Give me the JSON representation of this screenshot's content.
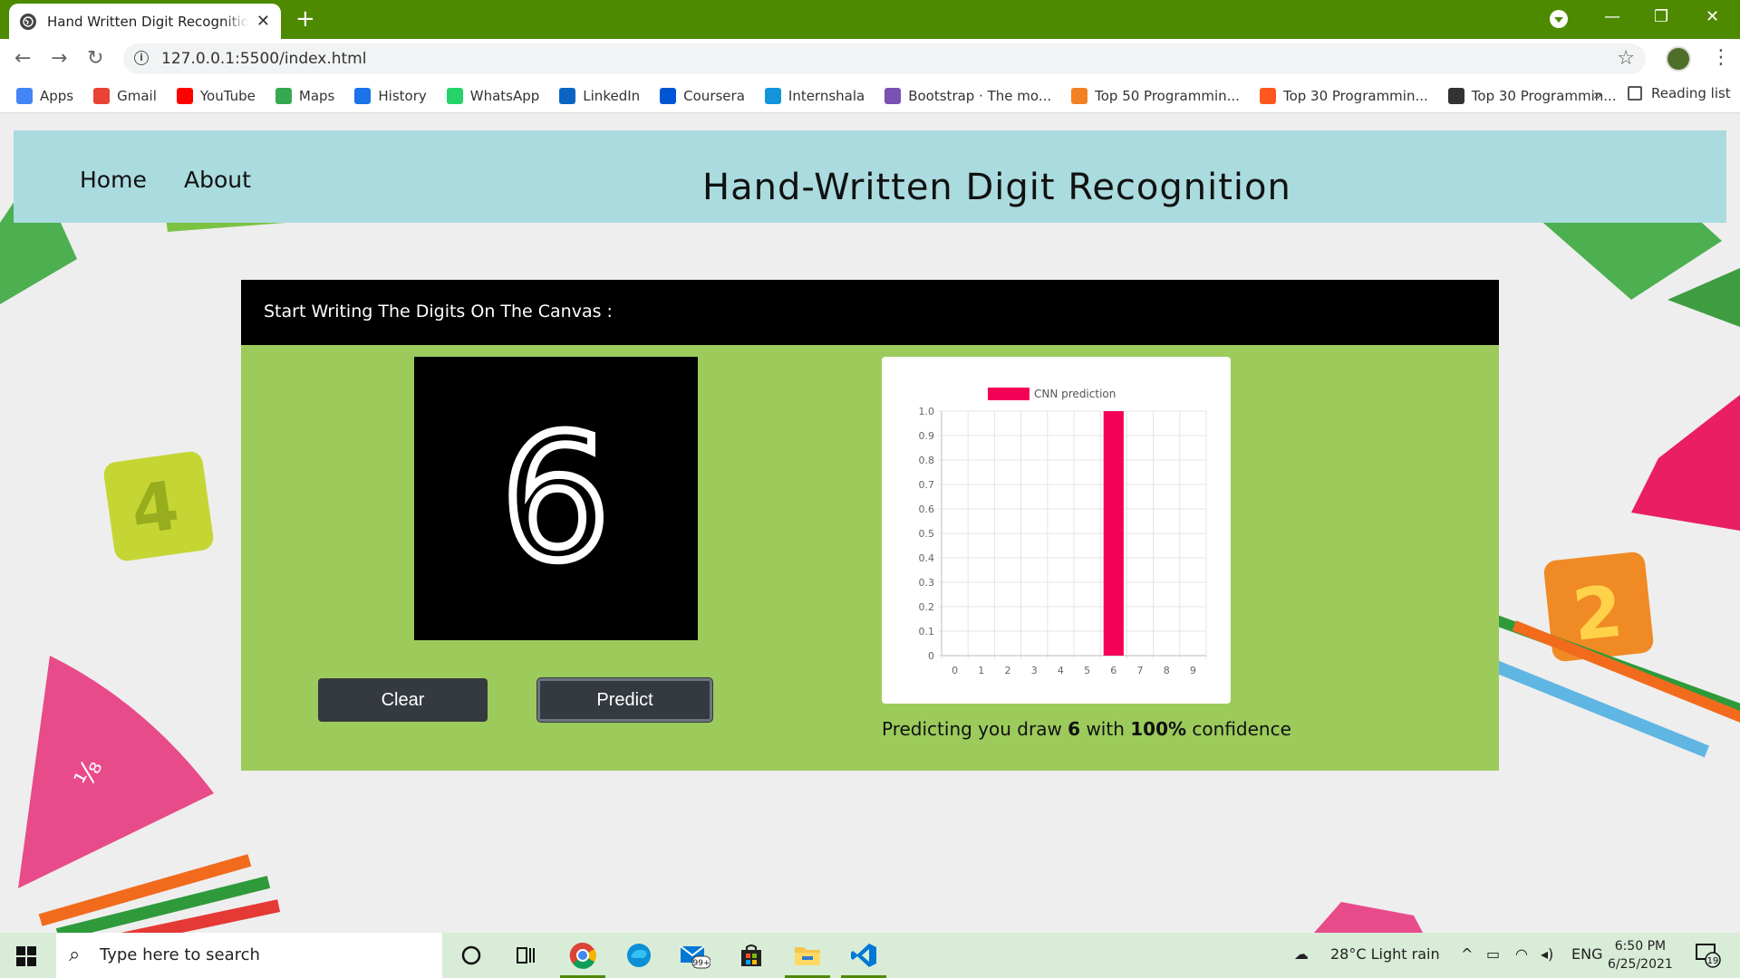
{
  "browser": {
    "tab_title": "Hand Written Digit Recognition u",
    "tab_close": "✕",
    "new_tab": "+",
    "url": "127.0.0.1:5500/index.html",
    "more_bookmarks": "»",
    "reading_list": "Reading list",
    "bookmarks": [
      {
        "label": "Apps",
        "icon": "apps-grid-icon",
        "color": "#4285f4"
      },
      {
        "label": "Gmail",
        "icon": "gmail-icon",
        "color": "#ea4335"
      },
      {
        "label": "YouTube",
        "icon": "youtube-icon",
        "color": "#ff0000"
      },
      {
        "label": "Maps",
        "icon": "maps-icon",
        "color": "#34a853"
      },
      {
        "label": "History",
        "icon": "history-icon",
        "color": "#1a73e8"
      },
      {
        "label": "WhatsApp",
        "icon": "whatsapp-icon",
        "color": "#25d366"
      },
      {
        "label": "LinkedIn",
        "icon": "linkedin-icon",
        "color": "#0a66c2"
      },
      {
        "label": "Coursera",
        "icon": "coursera-icon",
        "color": "#0056d2"
      },
      {
        "label": "Internshala",
        "icon": "internshala-icon",
        "color": "#1295db"
      },
      {
        "label": "Bootstrap · The mo...",
        "icon": "bootstrap-icon",
        "color": "#7952b3"
      },
      {
        "label": "Top 50 Programmin...",
        "icon": "sf-icon",
        "color": "#f48024"
      },
      {
        "label": "Top 30 Programmin...",
        "icon": "blogger-icon",
        "color": "#ff5722"
      },
      {
        "label": "Top 30 Programmin...",
        "icon": "site-icon",
        "color": "#333333"
      }
    ]
  },
  "navbar": {
    "links": [
      "Home",
      "About"
    ],
    "title": "Hand-Written Digit Recognition"
  },
  "card": {
    "header": "Start Writing The Digits On The Canvas :",
    "drawn_digit": "6",
    "clear_label": "Clear",
    "predict_label": "Predict"
  },
  "result": {
    "prefix": "Predicting you draw ",
    "digit": "6",
    "middle": " with ",
    "confidence": "100%",
    "suffix": " confidence"
  },
  "chart_data": {
    "type": "bar",
    "categories": [
      "0",
      "1",
      "2",
      "3",
      "4",
      "5",
      "6",
      "7",
      "8",
      "9"
    ],
    "series": [
      {
        "name": "CNN prediction",
        "values": [
          0,
          0,
          0,
          0,
          0,
          0,
          1.0,
          0,
          0,
          0
        ],
        "color": "#f50057"
      }
    ],
    "ylim": [
      0,
      1.0
    ],
    "yticks": [
      "0",
      "0.1",
      "0.2",
      "0.3",
      "0.4",
      "0.5",
      "0.6",
      "0.7",
      "0.8",
      "0.9",
      "1.0"
    ],
    "grid": true,
    "legend": "top"
  },
  "taskbar": {
    "search_placeholder": "Type here to search",
    "mail_badge": "99+",
    "weather": "28°C  Light rain",
    "language": "ENG",
    "time": "6:50 PM",
    "date": "6/25/2021",
    "notifications": "19"
  }
}
